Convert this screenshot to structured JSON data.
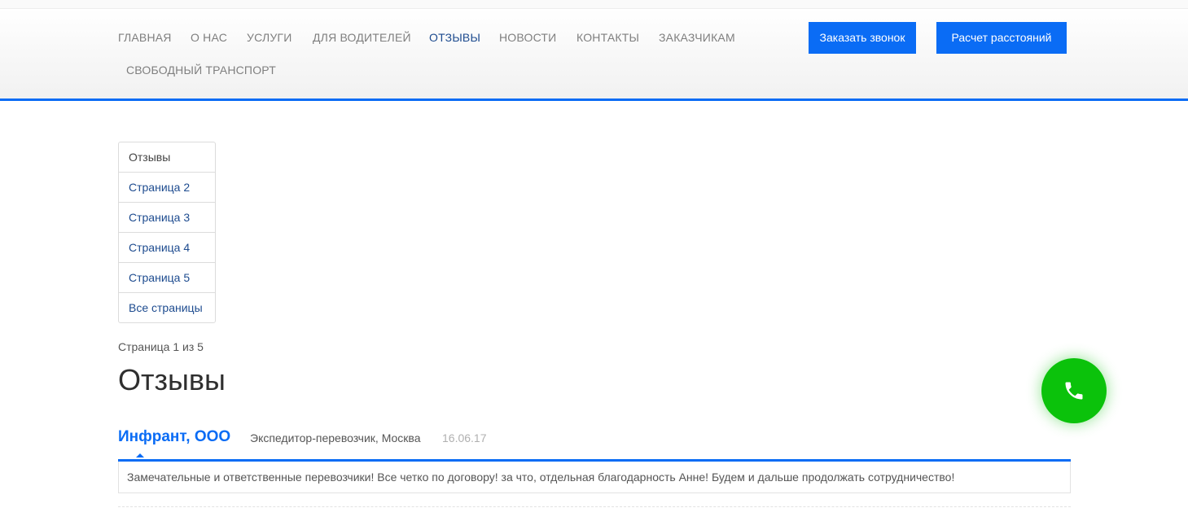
{
  "nav": {
    "items": [
      "ГЛАВНАЯ",
      "О НАС",
      "УСЛУГИ",
      "ДЛЯ ВОДИТЕЛЕЙ",
      "ОТЗЫВЫ",
      "НОВОСТИ",
      "КОНТАКТЫ",
      "ЗАКАЗЧИКАМ",
      "СВОБОДНЫЙ ТРАНСПОРТ"
    ],
    "active": "ОТЗЫВЫ"
  },
  "buttons": {
    "call": "Заказать звонок",
    "distance": "Расчет расстояний"
  },
  "subnav": {
    "items": [
      "Отзывы",
      "Страница 2",
      "Страница 3",
      "Страница 4",
      "Страница 5",
      "Все страницы"
    ]
  },
  "page": {
    "info": "Страница 1 из 5",
    "title": "Отзывы"
  },
  "review": {
    "company": "Инфрант, ООО",
    "meta": "Экспедитор-перевозчик, Москва",
    "date": "16.06.17",
    "text": "Замечательные и ответственные перевозчики! Все четко по договору! за что, отдельная благодарность Анне! Будем и дальше продолжать сотрудничество!"
  },
  "colors": {
    "accent": "#0a6cf5",
    "call_button": "#0bc20b",
    "nav_text": "#7f7f7f",
    "nav_active": "#1d4b8f"
  },
  "icons": {
    "call_button": "phone-icon"
  }
}
